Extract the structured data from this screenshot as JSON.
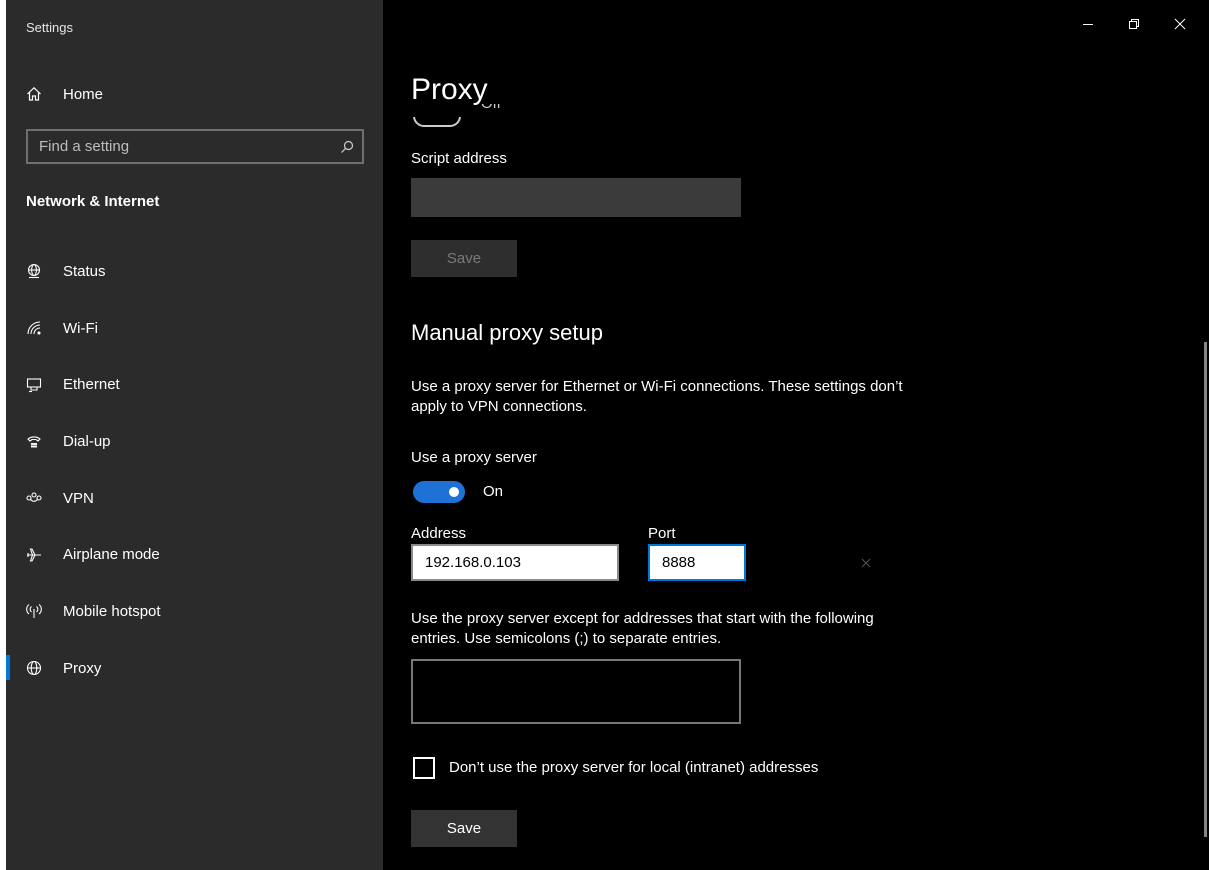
{
  "window": {
    "app_title": "Settings",
    "controls": {
      "minimize": "minimize-icon",
      "restore": "restore-icon",
      "close": "close-icon"
    }
  },
  "sidebar": {
    "home_label": "Home",
    "search_placeholder": "Find a setting",
    "section_title": "Network & Internet",
    "items": [
      {
        "label": "Status",
        "icon": "globe-status-icon"
      },
      {
        "label": "Wi-Fi",
        "icon": "wifi-icon"
      },
      {
        "label": "Ethernet",
        "icon": "ethernet-icon"
      },
      {
        "label": "Dial-up",
        "icon": "dialup-icon"
      },
      {
        "label": "VPN",
        "icon": "vpn-icon"
      },
      {
        "label": "Airplane mode",
        "icon": "airplane-icon"
      },
      {
        "label": "Mobile hotspot",
        "icon": "hotspot-icon"
      },
      {
        "label": "Proxy",
        "icon": "globe-icon",
        "selected": true
      }
    ]
  },
  "main": {
    "page_title": "Proxy",
    "auto_toggle_partial": "Off",
    "script_address_label": "Script address",
    "script_address_value": "",
    "script_save_label": "Save",
    "manual_title": "Manual proxy setup",
    "manual_desc": "Use a proxy server for Ethernet or Wi-Fi connections. These settings don’t apply to VPN connections.",
    "use_proxy_label": "Use a proxy server",
    "use_proxy_state": "On",
    "address_label": "Address",
    "address_value": "192.168.0.103",
    "port_label": "Port",
    "port_value": "8888",
    "exceptions_desc": "Use the proxy server except for addresses that start with the following entries. Use semicolons (;) to separate entries.",
    "exceptions_value": "",
    "local_checkbox_label": "Don’t use the proxy server for local (intranet) addresses",
    "save_label": "Save"
  },
  "colors": {
    "sidebar_bg": "#2b2b2b",
    "content_bg": "#000000",
    "accent": "#0078d7"
  }
}
